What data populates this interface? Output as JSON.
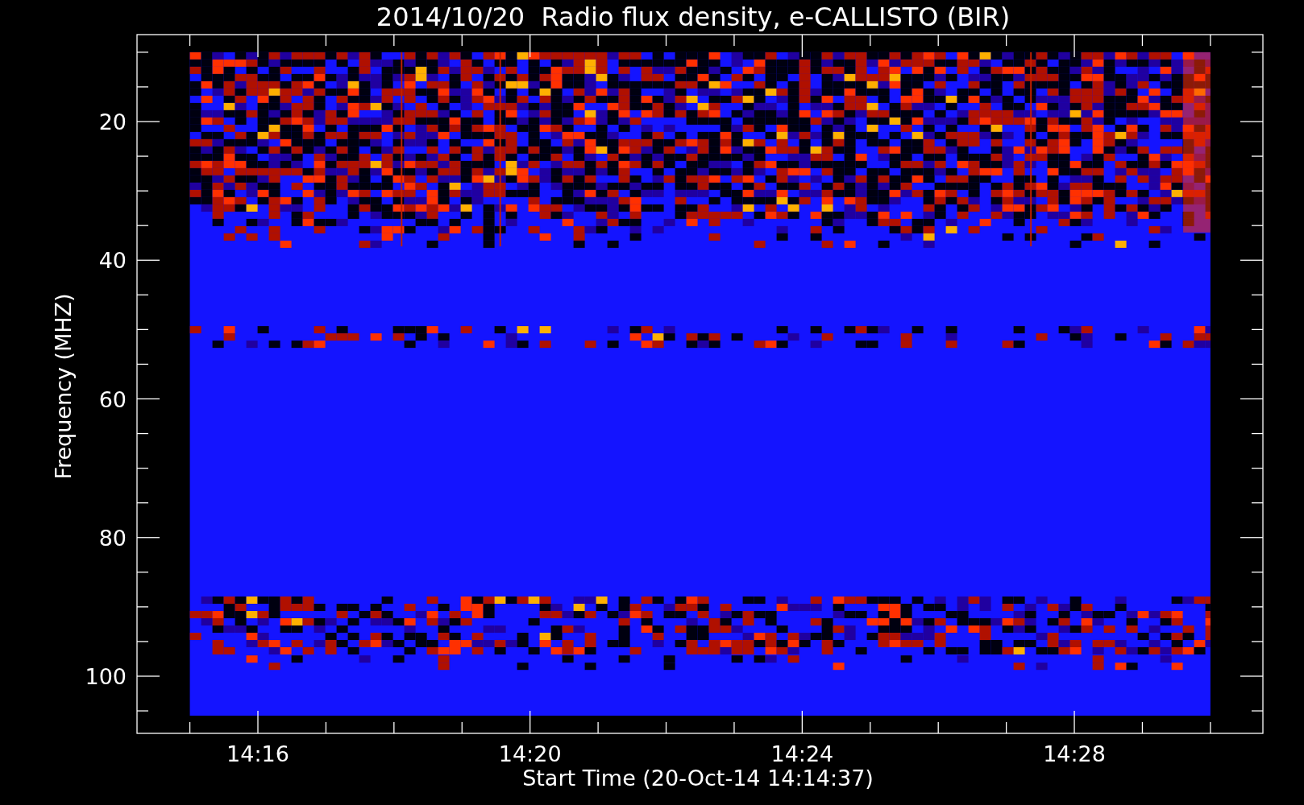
{
  "title": "2014/10/20  Radio flux density, e-CALLISTO (BIR)",
  "y_axis": {
    "label": "Frequency (MHZ)",
    "ticks": [
      "20",
      "40",
      "60",
      "80",
      "100"
    ]
  },
  "x_axis": {
    "label": "Start Time (20-Oct-14 14:14:37)",
    "ticks": [
      "14:16",
      "14:20",
      "14:24",
      "14:28"
    ]
  }
}
